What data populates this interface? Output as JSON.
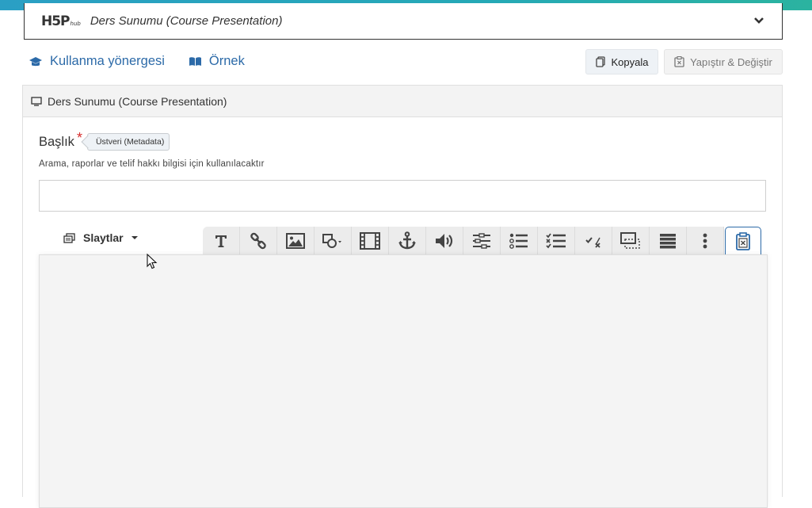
{
  "hub": {
    "logo_main": "H5P",
    "logo_sub": "hub",
    "title": "Ders Sunumu (Course Presentation)"
  },
  "links": {
    "tutorial": "Kullanma yönergesi",
    "example": "Örnek"
  },
  "actions": {
    "copy": "Kopyala",
    "paste_replace": "Yapıştır & Değiştir"
  },
  "panel": {
    "header": "Ders Sunumu (Course Presentation)",
    "title_field": {
      "label": "Başlık",
      "required_mark": "*",
      "meta_tag": "Üstveri (Metadata)",
      "description": "Arama, raporlar ve telif hakkı bilgisi için kullanılacaktır",
      "value": ""
    }
  },
  "editor": {
    "slides_menu": "Slaytlar",
    "toolbar_icons": [
      "text-icon",
      "link-icon",
      "image-icon",
      "shapes-icon",
      "video-icon",
      "anchor-icon",
      "audio-icon",
      "fill-blanks-icon",
      "single-choice-icon",
      "multiple-choice-icon",
      "true-false-icon",
      "drag-text-icon",
      "summary-icon",
      "more-icon",
      "paste-icon"
    ]
  },
  "colors": {
    "accent": "#2c6aa8",
    "topbar_start": "#2a9fc4",
    "topbar_end": "#2bb3a0",
    "required": "#d62c2c"
  }
}
